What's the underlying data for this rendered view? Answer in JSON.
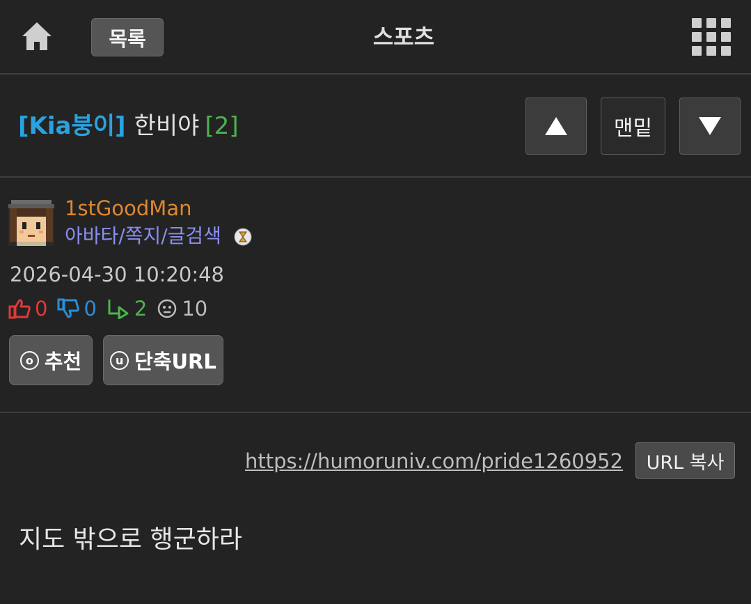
{
  "header": {
    "list_label": "목록",
    "board_title": "스포츠"
  },
  "post": {
    "category": "[Kia붕이]",
    "title": "한비야",
    "comment_count": "[2]"
  },
  "nav": {
    "bottom_label": "맨밑"
  },
  "author": {
    "name": "1stGoodMan",
    "links": "아바타/쪽지/글검색",
    "date": "2026-04-30 10:20:48"
  },
  "stats": {
    "upvotes": "0",
    "downvotes": "0",
    "replies": "2",
    "views": "10"
  },
  "actions": {
    "recommend_label": "추천",
    "recommend_key": "o",
    "shorturl_label": "단축URL",
    "shorturl_key": "u"
  },
  "url": {
    "link": "https://humoruniv.com/pride1260952",
    "copy_label": "URL 복사"
  },
  "body": {
    "text": "지도 밖으로 행군하라"
  },
  "colors": {
    "background": "#232323",
    "category": "#2aa2e0",
    "comment_count": "#4db34d",
    "author_name": "#e0872c",
    "author_links": "#8a8ff0",
    "upvote": "#e03a3a",
    "downvote": "#2a8fd8"
  }
}
